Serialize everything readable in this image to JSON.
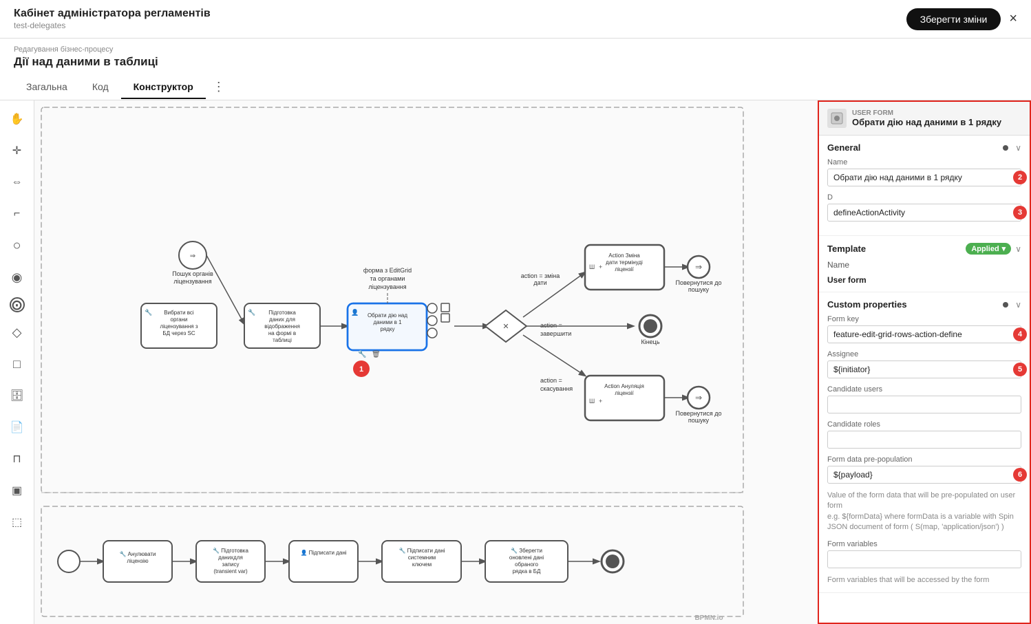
{
  "app": {
    "title": "Кабінет адміністратора регламентів",
    "subtitle": "test-delegates",
    "save_btn": "Зберегти зміни",
    "close_label": "×"
  },
  "breadcrumb": "Редагування бізнес-процесу",
  "page_title": "Дії над даними в таблиці",
  "tabs": [
    {
      "id": "general",
      "label": "Загальна",
      "active": false
    },
    {
      "id": "code",
      "label": "Код",
      "active": false
    },
    {
      "id": "constructor",
      "label": "Конструктор",
      "active": true
    }
  ],
  "more_icon": "⋮",
  "panel": {
    "type": "USER FORM",
    "name": "Обрати дію над даними в 1 рядку",
    "sections": {
      "general": {
        "title": "General",
        "name_label": "Name",
        "name_value": "Обрати дію над даними в 1 рядку",
        "id_label": "D",
        "id_value": "defineActionActivity"
      },
      "template": {
        "title": "Template",
        "badge": "Applied",
        "badge_arrow": "▾",
        "name_label": "Name",
        "name_value": "User form"
      },
      "custom": {
        "title": "Custom properties",
        "form_key_label": "Form key",
        "form_key_value": "feature-edit-grid-rows-action-define",
        "assignee_label": "Assignee",
        "assignee_value": "${initiator}",
        "candidate_users_label": "Candidate users",
        "candidate_users_value": "",
        "candidate_roles_label": "Candidate roles",
        "candidate_roles_value": "",
        "form_data_label": "Form data pre-population",
        "form_data_value": "${payload}",
        "form_data_help": "Value of the form data that will be pre-populated on user form\ne.g. ${formData} where formData is a variable with Spin JSON document of form ( S(map, 'application/json') )",
        "form_variables_label": "Form variables",
        "form_variables_value": "",
        "form_variables_help": "Form variables that will be accessed by the form"
      }
    }
  },
  "tools": [
    {
      "id": "hand",
      "icon": "✋"
    },
    {
      "id": "cross",
      "icon": "✛"
    },
    {
      "id": "move",
      "icon": "⇔"
    },
    {
      "id": "lasso",
      "icon": "⌐"
    },
    {
      "id": "circle-empty",
      "icon": "○"
    },
    {
      "id": "circle-filled",
      "icon": "◉"
    },
    {
      "id": "circle-thick",
      "icon": "⊙"
    },
    {
      "id": "diamond",
      "icon": "◇"
    },
    {
      "id": "square",
      "icon": "□"
    },
    {
      "id": "db-icon",
      "icon": "🗄"
    },
    {
      "id": "doc-icon",
      "icon": "📄"
    },
    {
      "id": "cylinder",
      "icon": "⊓"
    },
    {
      "id": "frame",
      "icon": "▣"
    },
    {
      "id": "select-box",
      "icon": "⬚"
    }
  ],
  "bpmn_footer": "BPMN.io",
  "badges": {
    "node1": "1",
    "field2": "2",
    "field3": "3",
    "field4": "4",
    "field5": "5",
    "field6": "6"
  }
}
